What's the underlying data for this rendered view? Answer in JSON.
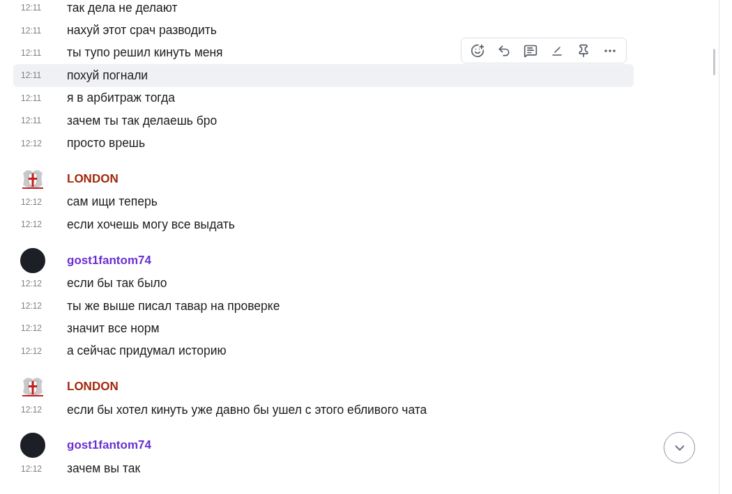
{
  "groups": [
    {
      "messages": [
        {
          "time": "12:11",
          "text": "так дела не делают",
          "highlighted": false
        },
        {
          "time": "12:11",
          "text": "нахуй этот срач разводить",
          "highlighted": false
        },
        {
          "time": "12:11",
          "text": "ты тупо решил кинуть меня",
          "highlighted": false
        },
        {
          "time": "12:11",
          "text": "похуй погнали",
          "highlighted": true
        },
        {
          "time": "12:11",
          "text": "я в арбитраж тогда",
          "highlighted": false
        },
        {
          "time": "12:11",
          "text": "зачем ты так делаешь бро",
          "highlighted": false
        },
        {
          "time": "12:12",
          "text": "просто врешь",
          "highlighted": false
        }
      ]
    },
    {
      "author": {
        "name": "LONDON",
        "color": "#a2280c",
        "kind": "crest"
      },
      "messages": [
        {
          "time": "12:12",
          "text": "сам ищи теперь",
          "highlighted": false
        },
        {
          "time": "12:12",
          "text": "если хочешь могу все выдать",
          "highlighted": false
        }
      ]
    },
    {
      "author": {
        "name": "gost1fantom74",
        "color": "#6a2fd3",
        "kind": "photo"
      },
      "messages": [
        {
          "time": "12:12",
          "text": "если бы так было",
          "highlighted": false
        },
        {
          "time": "12:12",
          "text": "ты же выше писал тавар на проверке",
          "highlighted": false
        },
        {
          "time": "12:12",
          "text": "значит все норм",
          "highlighted": false
        },
        {
          "time": "12:12",
          "text": "а сейчас придумал историю",
          "highlighted": false
        }
      ]
    },
    {
      "author": {
        "name": "LONDON",
        "color": "#a2280c",
        "kind": "crest"
      },
      "messages": [
        {
          "time": "12:12",
          "text": "если бы хотел кинуть уже давно бы ушел с этого ебливого чата",
          "highlighted": false
        }
      ]
    },
    {
      "author": {
        "name": "gost1fantom74",
        "color": "#6a2fd3",
        "kind": "photo"
      },
      "messages": [
        {
          "time": "12:12",
          "text": "зачем вы так",
          "highlighted": false
        }
      ]
    }
  ]
}
